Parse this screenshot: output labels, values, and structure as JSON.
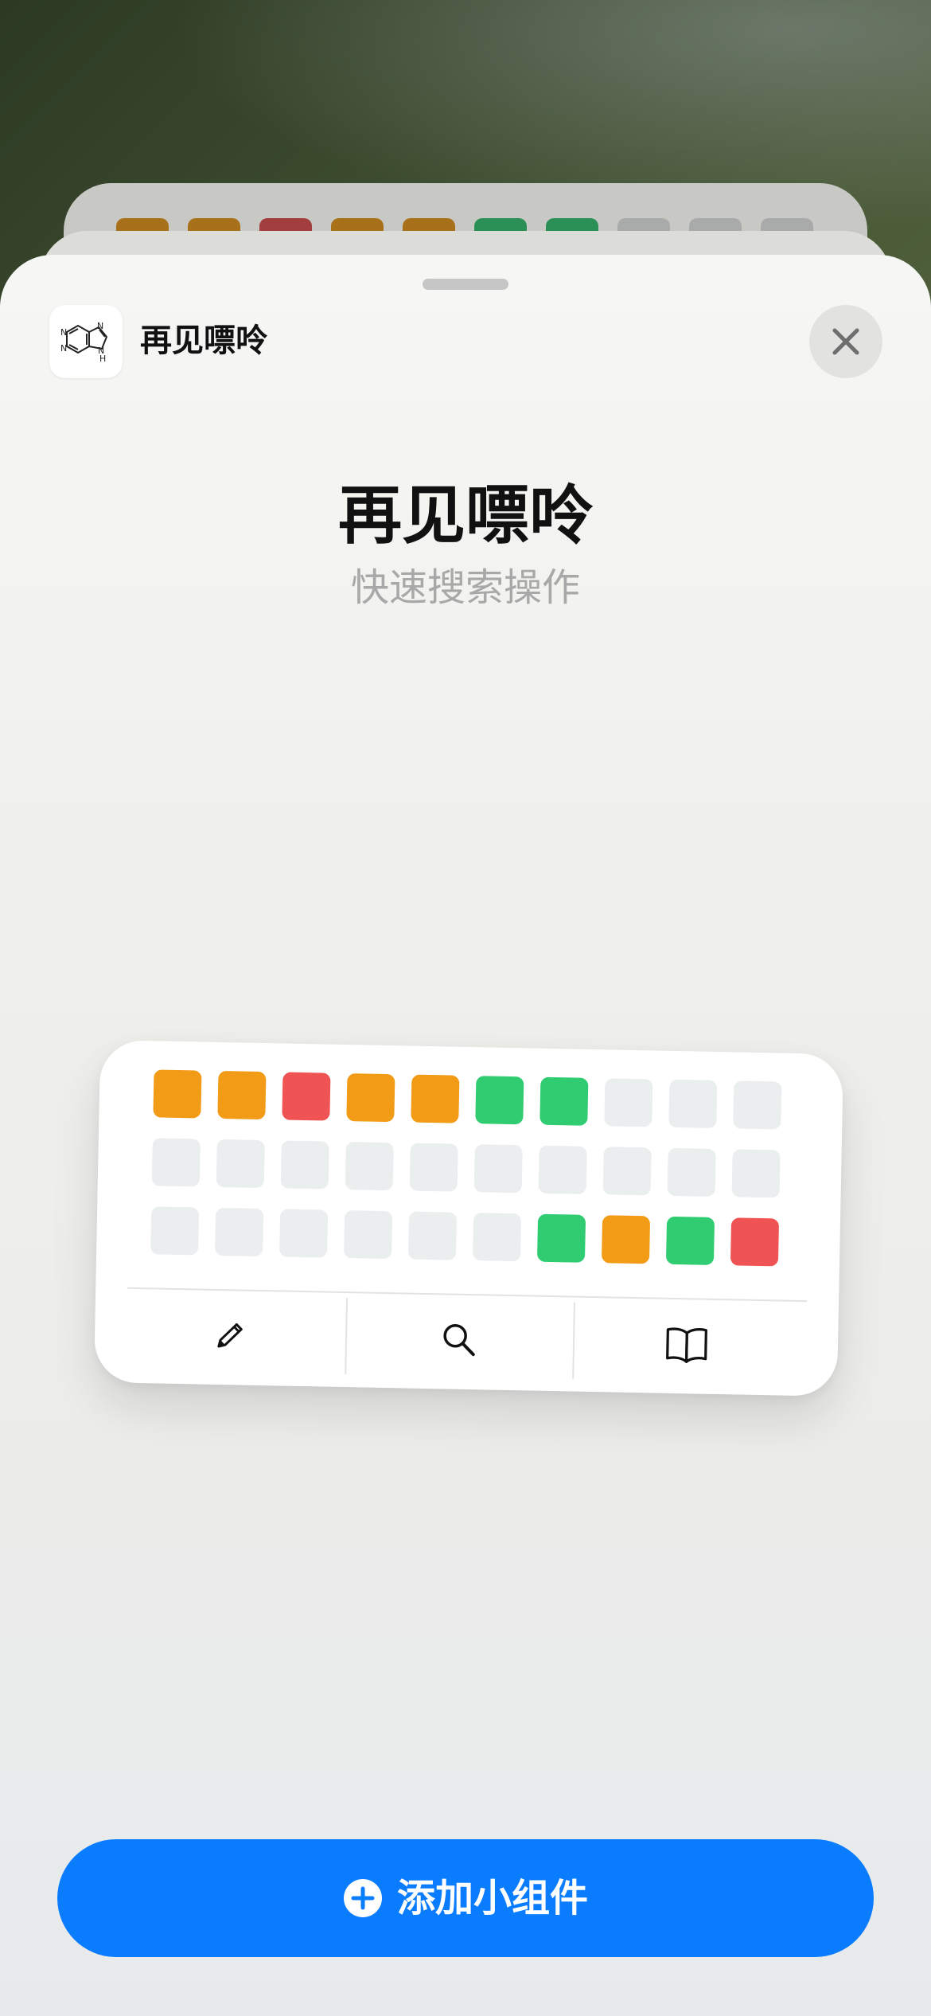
{
  "app": {
    "name": "再见嘌呤",
    "icon": "purine-molecule-icon"
  },
  "sheet": {
    "title": "再见嘌呤",
    "subtitle": "快速搜索操作"
  },
  "widget": {
    "grid_rows": [
      [
        "orange",
        "orange",
        "red",
        "orange",
        "orange",
        "green",
        "green",
        "empty",
        "empty",
        "empty"
      ],
      [
        "empty",
        "empty",
        "empty",
        "empty",
        "empty",
        "empty",
        "empty",
        "empty",
        "empty",
        "empty"
      ],
      [
        "empty",
        "empty",
        "empty",
        "empty",
        "empty",
        "empty",
        "green",
        "orange",
        "green",
        "red"
      ]
    ],
    "actions": [
      {
        "name": "edit",
        "icon": "pencil-icon"
      },
      {
        "name": "search",
        "icon": "search-icon"
      },
      {
        "name": "book",
        "icon": "book-icon"
      }
    ]
  },
  "background_peek_row": [
    "orange",
    "orange",
    "red",
    "orange",
    "orange",
    "green",
    "green",
    "empty",
    "empty",
    "empty"
  ],
  "colors": {
    "orange": "#f29b16",
    "red": "#ef5353",
    "green": "#2fcc71",
    "empty": "#ebeeee",
    "accent": "#0a7cff"
  },
  "add_button": {
    "label": "添加小组件",
    "icon": "plus-circle-icon"
  }
}
